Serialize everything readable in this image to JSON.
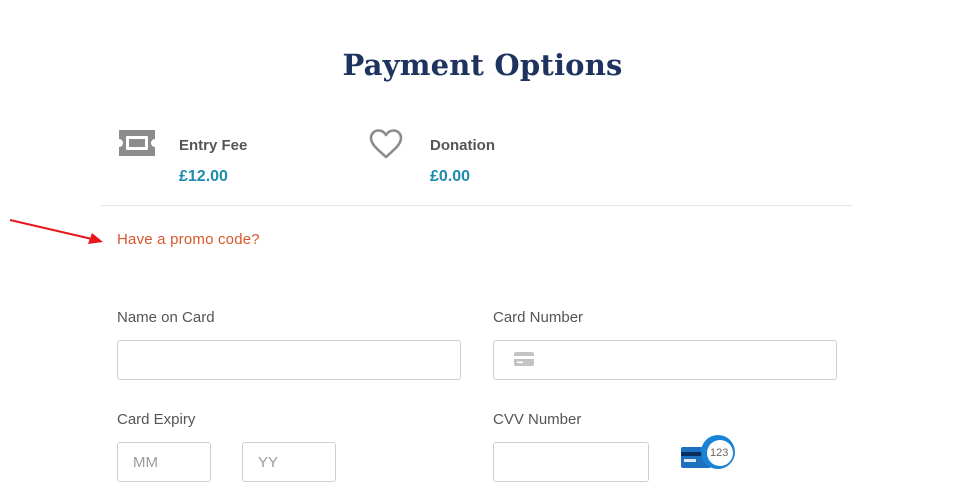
{
  "page": {
    "title": "Payment Options"
  },
  "summary": {
    "entry_fee": {
      "label": "Entry Fee",
      "amount": "£12.00",
      "icon": "ticket-icon"
    },
    "donation": {
      "label": "Donation",
      "amount": "£0.00",
      "icon": "heart-icon"
    }
  },
  "promo": {
    "link_label": "Have a promo code?"
  },
  "form": {
    "name_on_card": {
      "label": "Name on Card",
      "value": "",
      "placeholder": ""
    },
    "card_number": {
      "label": "Card Number",
      "value": "",
      "placeholder": "",
      "icon": "credit-card-icon"
    },
    "card_expiry": {
      "label": "Card Expiry",
      "month": {
        "value": "",
        "placeholder": "MM"
      },
      "year": {
        "value": "",
        "placeholder": "YY"
      }
    },
    "cvv": {
      "label": "CVV Number",
      "value": "",
      "placeholder": "",
      "hint_text": "123",
      "icon": "cvv-card-icon"
    }
  },
  "colors": {
    "title": "#1f3360",
    "amount": "#1c8bb0",
    "promo": "#d9562c",
    "annotation_arrow": "#e8171b"
  }
}
